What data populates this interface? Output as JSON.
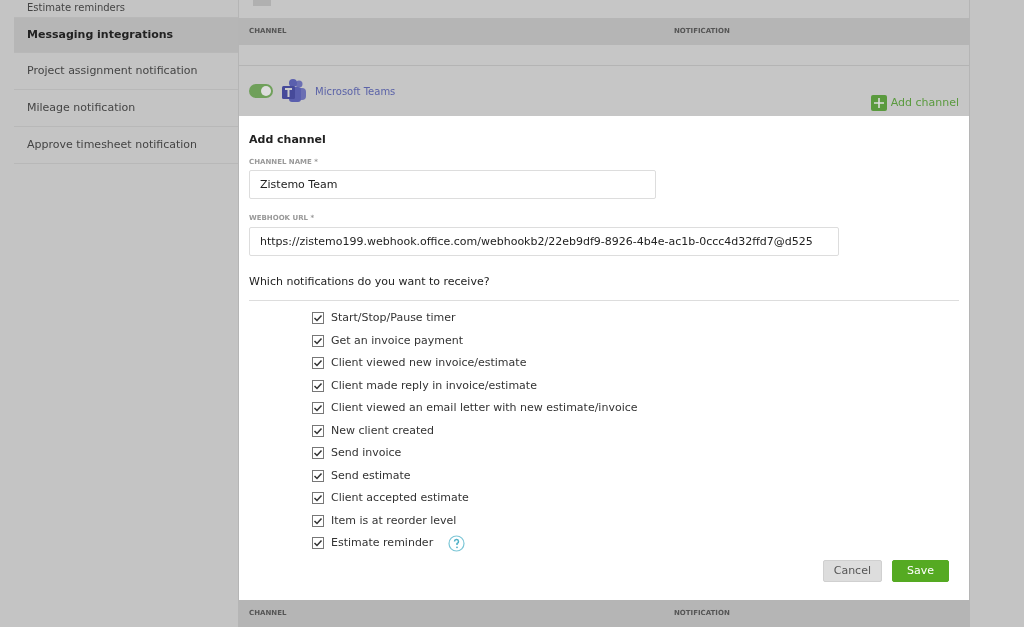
{
  "sidebar": {
    "items": [
      {
        "label": "Estimate reminders",
        "selected": false
      },
      {
        "label": "Messaging integrations",
        "selected": true
      },
      {
        "label": "Project assignment notification",
        "selected": false
      },
      {
        "label": "Mileage notification",
        "selected": false
      },
      {
        "label": "Approve timesheet notification",
        "selected": false
      }
    ]
  },
  "table": {
    "columns": [
      "CHANNEL",
      "NOTIFICATION"
    ]
  },
  "integration": {
    "name": "Microsoft Teams",
    "on": true,
    "add_link": "Add channel"
  },
  "form": {
    "title": "Add channel",
    "fields": [
      {
        "label": "CHANNEL NAME *",
        "value": "Zistemo Team"
      },
      {
        "label": "WEBHOOK URL *",
        "value": "https://zistemo199.webhook.office.com/webhookb2/22eb9df9-8926-4b4e-ac1b-0ccc4d32ffd7@d525"
      }
    ],
    "question": "Which notifications do you want to receive?",
    "notifications": [
      {
        "label": "Start/Stop/Pause timer",
        "checked": true,
        "help": false
      },
      {
        "label": "Get an invoice payment",
        "checked": true,
        "help": false
      },
      {
        "label": "Client viewed new invoice/estimate",
        "checked": true,
        "help": false
      },
      {
        "label": "Client made reply in invoice/estimate",
        "checked": true,
        "help": false
      },
      {
        "label": "Client viewed an email letter with new estimate/invoice",
        "checked": true,
        "help": false
      },
      {
        "label": "New client created",
        "checked": true,
        "help": false
      },
      {
        "label": "Send invoice",
        "checked": true,
        "help": false
      },
      {
        "label": "Send estimate",
        "checked": true,
        "help": false
      },
      {
        "label": "Client accepted estimate",
        "checked": true,
        "help": false
      },
      {
        "label": "Item is at reorder level",
        "checked": true,
        "help": false
      },
      {
        "label": "Estimate reminder",
        "checked": true,
        "help": true
      }
    ],
    "buttons": [
      {
        "label": "Cancel",
        "kind": "secondary"
      },
      {
        "label": "Save",
        "kind": "primary"
      }
    ]
  },
  "bottom_table": {
    "columns": [
      "CHANNEL",
      "NOTIFICATION"
    ]
  }
}
